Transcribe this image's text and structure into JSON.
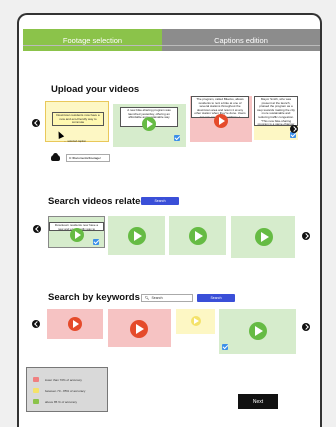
{
  "tabs": {
    "footage": "Footage selection",
    "captions": "Captions edition"
  },
  "sections": {
    "upload": "Upload your videos",
    "related": "Search videos related",
    "keywords": "Search by keywords"
  },
  "upload": {
    "captions": [
      "Downtown residents now have a new and eco-friendly way to commute",
      "A new bike-sharing program was launched yesterday, offering an affordable and sustainable way",
      "The program, called BikeGo, allows residents to rent a bike at one of several stations throughout the downtown area and return it at any other station when they're done. Users can pay per ride or purchase a monthly subscription.",
      "Mayor Smith, who was present at the launch, praised the program as a step towards making the city more sustainable and reducing traffic congestion. \"This new bike-sharing program is a game-changer for downtown residents,\" he said."
    ],
    "cursor_note": "← selected caption",
    "path": "C:/Documents/Footage/"
  },
  "related": {
    "caption": "Downtown residents now have a new and eco-friendly way to commute",
    "search_label": "Search"
  },
  "keywords": {
    "query": "Search",
    "search_label": "Search"
  },
  "legend": {
    "items": [
      {
        "label": "lower than 70% of accuracy",
        "color": "#f08080"
      },
      {
        "label": "between 70 - 85% of accuracy",
        "color": "#f4e26a"
      },
      {
        "label": "above 85 % of accuracy",
        "color": "#8bc34a"
      }
    ]
  },
  "next_label": "Next",
  "icons": {
    "play": "play-icon",
    "arrow_left": "chevron-left-icon",
    "arrow_right": "chevron-right-icon",
    "check": "checkbox-checked-icon",
    "cloud": "cloud-upload-icon",
    "search": "search-icon"
  },
  "colors": {
    "accent_green": "#8bc34a",
    "tab_gray": "#8c8c8c",
    "search_blue": "#3a4fd8",
    "thumb_green": "#d6eccc",
    "thumb_red": "#f6c3c3",
    "thumb_yellow": "#fdf7c4"
  }
}
